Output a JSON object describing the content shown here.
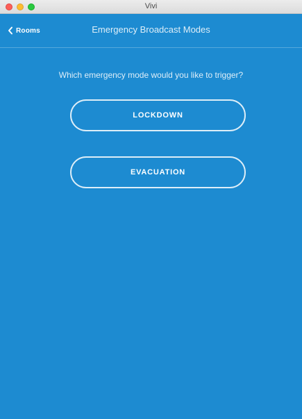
{
  "window": {
    "title": "Vivi"
  },
  "navbar": {
    "back_label": "Rooms",
    "title": "Emergency Broadcast Modes"
  },
  "main": {
    "prompt": "Which emergency mode would you like to trigger?",
    "modes": [
      {
        "label": "LOCKDOWN"
      },
      {
        "label": "EVACUATION"
      }
    ]
  },
  "colors": {
    "background": "#1d8bd1",
    "text": "#ffffff"
  }
}
